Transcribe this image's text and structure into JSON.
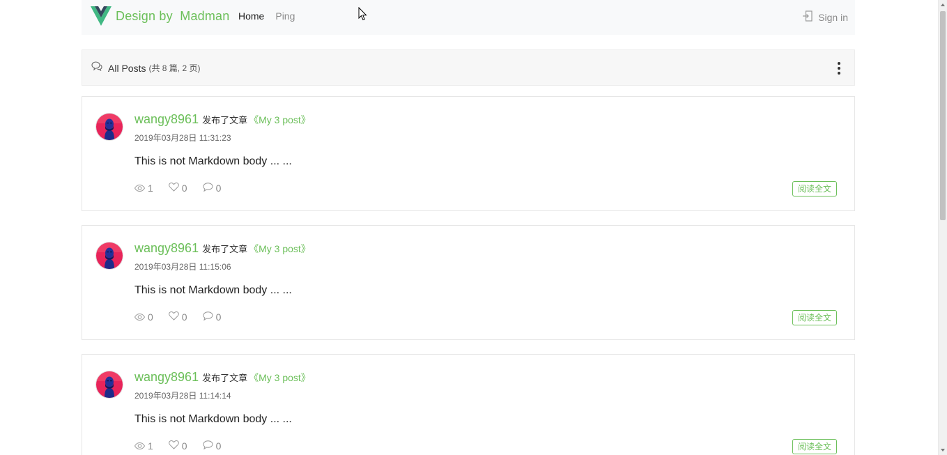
{
  "navbar": {
    "brand_text": "Design by  Madman",
    "links": [
      {
        "label": "Home",
        "active": true
      },
      {
        "label": "Ping",
        "active": false
      }
    ],
    "signin_label": "Sign in"
  },
  "posts_header": {
    "title": "All Posts",
    "count_text": "(共 8 篇, 2 页)"
  },
  "colors": {
    "accent": "#6bbf59",
    "navbar_bg": "#f8f9fa",
    "header_bg": "#f7f7f7"
  },
  "icons": {
    "brand": "vue-logo-icon",
    "signin": "sign-in-icon",
    "posts": "comments-icon",
    "menu": "kebab-menu-icon",
    "views": "eye-icon",
    "likes": "heart-icon",
    "comments": "comment-icon"
  },
  "posts": [
    {
      "author": "wangy8961",
      "action": "发布了文章",
      "title": "《My 3 post》",
      "timestamp": "2019年03月28日 11:31:23",
      "body": "This is not Markdown body ... ...",
      "views": "1",
      "likes": "0",
      "comments": "0",
      "read_more": "阅读全文"
    },
    {
      "author": "wangy8961",
      "action": "发布了文章",
      "title": "《My 3 post》",
      "timestamp": "2019年03月28日 11:15:06",
      "body": "This is not Markdown body ... ...",
      "views": "0",
      "likes": "0",
      "comments": "0",
      "read_more": "阅读全文"
    },
    {
      "author": "wangy8961",
      "action": "发布了文章",
      "title": "《My 3 post》",
      "timestamp": "2019年03月28日 11:14:14",
      "body": "This is not Markdown body ... ...",
      "views": "1",
      "likes": "0",
      "comments": "0",
      "read_more": "阅读全文"
    }
  ]
}
